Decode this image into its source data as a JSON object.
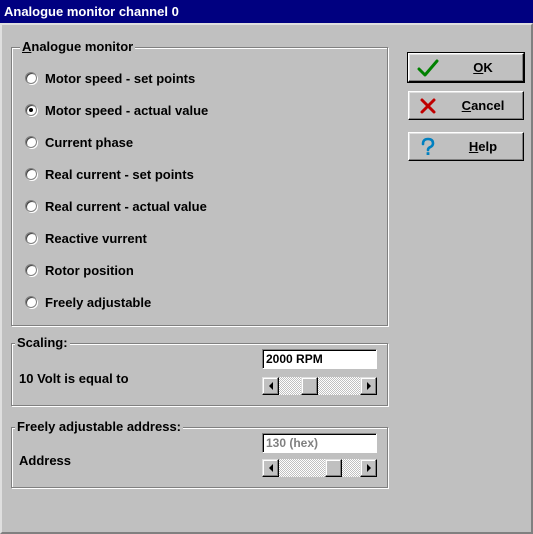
{
  "window": {
    "title": "Analogue monitor channel 0"
  },
  "analogue_monitor": {
    "title_prefix": "",
    "title_mnemonic": "A",
    "title_rest": "nalogue monitor",
    "options": [
      {
        "label": "Motor speed - set points",
        "checked": false
      },
      {
        "label": "Motor speed - actual value",
        "checked": true
      },
      {
        "label": "Current phase",
        "checked": false
      },
      {
        "label": "Real current - set points",
        "checked": false
      },
      {
        "label": "Real current - actual value",
        "checked": false
      },
      {
        "label": "Reactive vurrent",
        "checked": false
      },
      {
        "label": "Rotor position",
        "checked": false
      },
      {
        "label": "Freely adjustable",
        "checked": false
      }
    ]
  },
  "scaling": {
    "title": "Scaling:",
    "label": "10 Volt is equal to",
    "value": "2000 RPM",
    "scroll_position": 0.35
  },
  "address_group": {
    "title": "Freely adjustable address:",
    "label": "Address",
    "value": "130 (hex)",
    "scroll_position": 0.72
  },
  "buttons": {
    "ok": {
      "mnemonic": "O",
      "rest": "K",
      "icon": "check-icon"
    },
    "cancel": {
      "mnemonic": "C",
      "rest": "ancel",
      "icon": "cross-icon"
    },
    "help": {
      "mnemonic": "H",
      "rest": "elp",
      "icon": "question-icon"
    }
  },
  "colors": {
    "title_bar": "#000080",
    "dialog_bg": "#c0c0c0",
    "ok_check": "#008000",
    "cancel_cross": "#c00000",
    "help_question": "#0080c0"
  }
}
